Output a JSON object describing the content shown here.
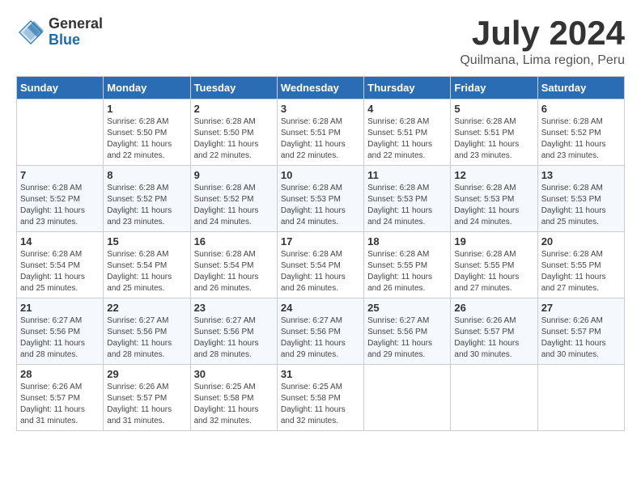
{
  "logo": {
    "general": "General",
    "blue": "Blue"
  },
  "title": "July 2024",
  "location": "Quilmana, Lima region, Peru",
  "headers": [
    "Sunday",
    "Monday",
    "Tuesday",
    "Wednesday",
    "Thursday",
    "Friday",
    "Saturday"
  ],
  "weeks": [
    [
      {
        "day": "",
        "info": ""
      },
      {
        "day": "1",
        "info": "Sunrise: 6:28 AM\nSunset: 5:50 PM\nDaylight: 11 hours\nand 22 minutes."
      },
      {
        "day": "2",
        "info": "Sunrise: 6:28 AM\nSunset: 5:50 PM\nDaylight: 11 hours\nand 22 minutes."
      },
      {
        "day": "3",
        "info": "Sunrise: 6:28 AM\nSunset: 5:51 PM\nDaylight: 11 hours\nand 22 minutes."
      },
      {
        "day": "4",
        "info": "Sunrise: 6:28 AM\nSunset: 5:51 PM\nDaylight: 11 hours\nand 22 minutes."
      },
      {
        "day": "5",
        "info": "Sunrise: 6:28 AM\nSunset: 5:51 PM\nDaylight: 11 hours\nand 23 minutes."
      },
      {
        "day": "6",
        "info": "Sunrise: 6:28 AM\nSunset: 5:52 PM\nDaylight: 11 hours\nand 23 minutes."
      }
    ],
    [
      {
        "day": "7",
        "info": "Sunrise: 6:28 AM\nSunset: 5:52 PM\nDaylight: 11 hours\nand 23 minutes."
      },
      {
        "day": "8",
        "info": "Sunrise: 6:28 AM\nSunset: 5:52 PM\nDaylight: 11 hours\nand 23 minutes."
      },
      {
        "day": "9",
        "info": "Sunrise: 6:28 AM\nSunset: 5:52 PM\nDaylight: 11 hours\nand 24 minutes."
      },
      {
        "day": "10",
        "info": "Sunrise: 6:28 AM\nSunset: 5:53 PM\nDaylight: 11 hours\nand 24 minutes."
      },
      {
        "day": "11",
        "info": "Sunrise: 6:28 AM\nSunset: 5:53 PM\nDaylight: 11 hours\nand 24 minutes."
      },
      {
        "day": "12",
        "info": "Sunrise: 6:28 AM\nSunset: 5:53 PM\nDaylight: 11 hours\nand 24 minutes."
      },
      {
        "day": "13",
        "info": "Sunrise: 6:28 AM\nSunset: 5:53 PM\nDaylight: 11 hours\nand 25 minutes."
      }
    ],
    [
      {
        "day": "14",
        "info": "Sunrise: 6:28 AM\nSunset: 5:54 PM\nDaylight: 11 hours\nand 25 minutes."
      },
      {
        "day": "15",
        "info": "Sunrise: 6:28 AM\nSunset: 5:54 PM\nDaylight: 11 hours\nand 25 minutes."
      },
      {
        "day": "16",
        "info": "Sunrise: 6:28 AM\nSunset: 5:54 PM\nDaylight: 11 hours\nand 26 minutes."
      },
      {
        "day": "17",
        "info": "Sunrise: 6:28 AM\nSunset: 5:54 PM\nDaylight: 11 hours\nand 26 minutes."
      },
      {
        "day": "18",
        "info": "Sunrise: 6:28 AM\nSunset: 5:55 PM\nDaylight: 11 hours\nand 26 minutes."
      },
      {
        "day": "19",
        "info": "Sunrise: 6:28 AM\nSunset: 5:55 PM\nDaylight: 11 hours\nand 27 minutes."
      },
      {
        "day": "20",
        "info": "Sunrise: 6:28 AM\nSunset: 5:55 PM\nDaylight: 11 hours\nand 27 minutes."
      }
    ],
    [
      {
        "day": "21",
        "info": "Sunrise: 6:27 AM\nSunset: 5:56 PM\nDaylight: 11 hours\nand 28 minutes."
      },
      {
        "day": "22",
        "info": "Sunrise: 6:27 AM\nSunset: 5:56 PM\nDaylight: 11 hours\nand 28 minutes."
      },
      {
        "day": "23",
        "info": "Sunrise: 6:27 AM\nSunset: 5:56 PM\nDaylight: 11 hours\nand 28 minutes."
      },
      {
        "day": "24",
        "info": "Sunrise: 6:27 AM\nSunset: 5:56 PM\nDaylight: 11 hours\nand 29 minutes."
      },
      {
        "day": "25",
        "info": "Sunrise: 6:27 AM\nSunset: 5:56 PM\nDaylight: 11 hours\nand 29 minutes."
      },
      {
        "day": "26",
        "info": "Sunrise: 6:26 AM\nSunset: 5:57 PM\nDaylight: 11 hours\nand 30 minutes."
      },
      {
        "day": "27",
        "info": "Sunrise: 6:26 AM\nSunset: 5:57 PM\nDaylight: 11 hours\nand 30 minutes."
      }
    ],
    [
      {
        "day": "28",
        "info": "Sunrise: 6:26 AM\nSunset: 5:57 PM\nDaylight: 11 hours\nand 31 minutes."
      },
      {
        "day": "29",
        "info": "Sunrise: 6:26 AM\nSunset: 5:57 PM\nDaylight: 11 hours\nand 31 minutes."
      },
      {
        "day": "30",
        "info": "Sunrise: 6:25 AM\nSunset: 5:58 PM\nDaylight: 11 hours\nand 32 minutes."
      },
      {
        "day": "31",
        "info": "Sunrise: 6:25 AM\nSunset: 5:58 PM\nDaylight: 11 hours\nand 32 minutes."
      },
      {
        "day": "",
        "info": ""
      },
      {
        "day": "",
        "info": ""
      },
      {
        "day": "",
        "info": ""
      }
    ]
  ]
}
